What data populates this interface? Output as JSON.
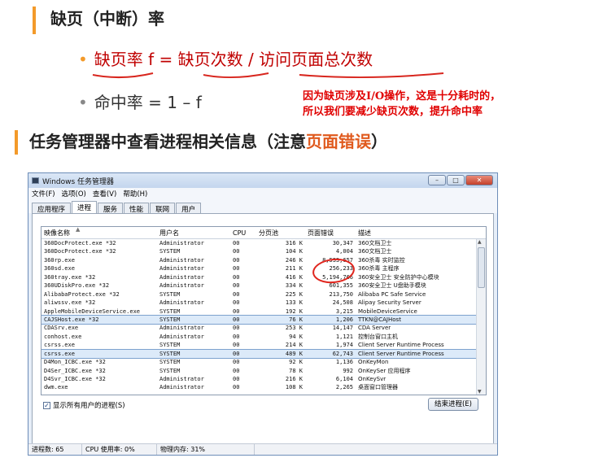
{
  "slide": {
    "heading1": "缺页（中断）率",
    "formula_missrate": "缺页率 f = 缺页次数 / 访问页面总次数",
    "formula_hitrate": "命中率 = 1 – f",
    "note_line1": "因为缺页涉及I/O操作，这是十分耗时的，",
    "note_line2": "所以我们要减少缺页次数，提升命中率",
    "heading2_prefix": "任务管理器中查看进程相关信息（注意",
    "heading2_highlight": "页面错误",
    "heading2_suffix": "）",
    "accent_color": "#f39a2a",
    "note_color": "#e00000"
  },
  "window": {
    "title": "Windows 任务管理器",
    "menu": [
      "文件(F)",
      "选项(O)",
      "查看(V)",
      "帮助(H)"
    ],
    "tabs": [
      "应用程序",
      "进程",
      "服务",
      "性能",
      "联网",
      "用户"
    ],
    "active_tab": "进程",
    "columns": [
      "映像名称",
      "用户名",
      "CPU",
      "分页池",
      "页面错误",
      "描述"
    ],
    "rows": [
      [
        "360DocProtect.exe *32",
        "Administrator",
        "00",
        "316 K",
        "30,347",
        "360文档卫士"
      ],
      [
        "360DocProtect.exe *32",
        "SYSTEM",
        "00",
        "104 K",
        "4,004",
        "360文档卫士"
      ],
      [
        "360rp.exe",
        "Administrator",
        "00",
        "246 K",
        "8,533,657",
        "360杀毒 实时监控"
      ],
      [
        "360sd.exe",
        "Administrator",
        "00",
        "211 K",
        "256,233",
        "360杀毒 主程序"
      ],
      [
        "360tray.exe *32",
        "Administrator",
        "00",
        "416 K",
        "5,194,766",
        "360安全卫士 安全防护中心模块"
      ],
      [
        "360UDiskPro.exe *32",
        "Administrator",
        "00",
        "334 K",
        "601,355",
        "360安全卫士 U盘助手模块"
      ],
      [
        "AlibabaProtect.exe *32",
        "SYSTEM",
        "00",
        "225 K",
        "213,750",
        "Alibaba PC Safe Service"
      ],
      [
        "aliwssv.exe *32",
        "Administrator",
        "00",
        "133 K",
        "24,508",
        "Alipay Security Server"
      ],
      [
        "AppleMobileDeviceService.exe",
        "SYSTEM",
        "00",
        "192 K",
        "3,215",
        "MobileDeviceService"
      ],
      [
        "CAJSHost.exe *32",
        "SYSTEM",
        "00",
        "76 K",
        "1,206",
        "TTKN@CAJHost"
      ],
      [
        "CDASrv.exe",
        "Administrator",
        "00",
        "253 K",
        "14,147",
        "CDA Server"
      ],
      [
        "conhost.exe",
        "Administrator",
        "00",
        "94 K",
        "1,121",
        "控制台窗口主机"
      ],
      [
        "csrss.exe",
        "SYSTEM",
        "00",
        "214 K",
        "1,974",
        "Client Server Runtime Process"
      ],
      [
        "csrss.exe",
        "SYSTEM",
        "00",
        "489 K",
        "62,743",
        "Client Server Runtime Process"
      ],
      [
        "D4Mon_ICBC.exe *32",
        "SYSTEM",
        "00",
        "92 K",
        "1,136",
        "OnKeyMon"
      ],
      [
        "D4Ser_ICBC.exe *32",
        "SYSTEM",
        "00",
        "78 K",
        "992",
        "OnKeySer 应用程序"
      ],
      [
        "D4Svr_ICBC.exe *32",
        "Administrator",
        "00",
        "216 K",
        "6,104",
        "OnKeySvr"
      ],
      [
        "dwm.exe",
        "Administrator",
        "00",
        "108 K",
        "2,265",
        "桌面窗口管理器"
      ]
    ],
    "selected_row": 9,
    "highlight_row": 13,
    "show_all_label": "显示所有用户的进程(S)",
    "end_process_label": "结束进程(E)",
    "status": {
      "processes": "进程数: 65",
      "cpu": "CPU 使用率: 0%",
      "memory": "物理内存: 31%"
    },
    "window_buttons": [
      "minimize-icon",
      "maximize-icon",
      "close-icon"
    ]
  }
}
